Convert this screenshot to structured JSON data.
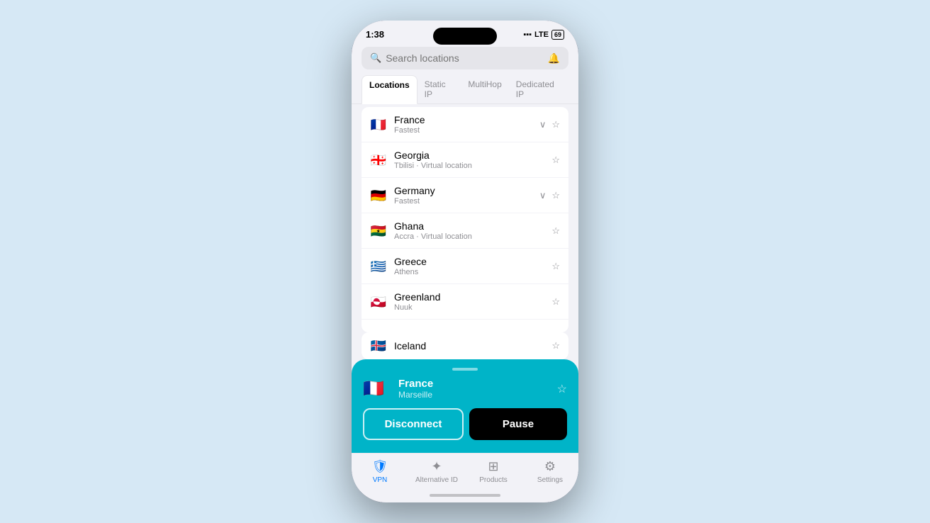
{
  "status_bar": {
    "time": "1:38",
    "signal": "●●●",
    "network_type": "LTE",
    "battery": "69"
  },
  "search": {
    "placeholder": "Search locations",
    "bell_icon": "bell"
  },
  "tabs": [
    {
      "id": "locations",
      "label": "Locations",
      "active": true
    },
    {
      "id": "static",
      "label": "Static IP",
      "active": false
    },
    {
      "id": "multihop",
      "label": "MultiHop",
      "active": false
    },
    {
      "id": "dedicated",
      "label": "Dedicated IP",
      "active": false
    }
  ],
  "locations": [
    {
      "id": "france",
      "flag": "🇫🇷",
      "name": "France",
      "sub": "Fastest",
      "has_expand": true,
      "has_star": true
    },
    {
      "id": "georgia",
      "flag": "🇬🇪",
      "name": "Georgia",
      "sub": "Tbilisi · Virtual location",
      "has_expand": false,
      "has_star": true
    },
    {
      "id": "germany",
      "flag": "🇩🇪",
      "name": "Germany",
      "sub": "Fastest",
      "has_expand": true,
      "has_star": true
    },
    {
      "id": "ghana",
      "flag": "🇬🇭",
      "name": "Ghana",
      "sub": "Accra · Virtual location",
      "has_expand": false,
      "has_star": true
    },
    {
      "id": "greece",
      "flag": "🇬🇷",
      "name": "Greece",
      "sub": "Athens",
      "has_expand": false,
      "has_star": true
    },
    {
      "id": "greenland",
      "flag": "🇬🇱",
      "name": "Greenland",
      "sub": "Nuuk",
      "has_expand": false,
      "has_star": true
    }
  ],
  "bottom_card": {
    "connected_flag": "🇫🇷",
    "connected_country": "France",
    "connected_city": "Marseille",
    "disconnect_label": "Disconnect",
    "pause_label": "Pause"
  },
  "iceland_peek": {
    "flag": "🇮🇸",
    "name": "Iceland"
  },
  "tab_bar": [
    {
      "id": "vpn",
      "icon": "🛡",
      "label": "VPN",
      "active": true
    },
    {
      "id": "alt_id",
      "icon": "✦",
      "label": "Alternative ID",
      "active": false
    },
    {
      "id": "products",
      "icon": "⊞",
      "label": "Products",
      "active": false
    },
    {
      "id": "settings",
      "icon": "⚙",
      "label": "Settings",
      "active": false
    }
  ]
}
